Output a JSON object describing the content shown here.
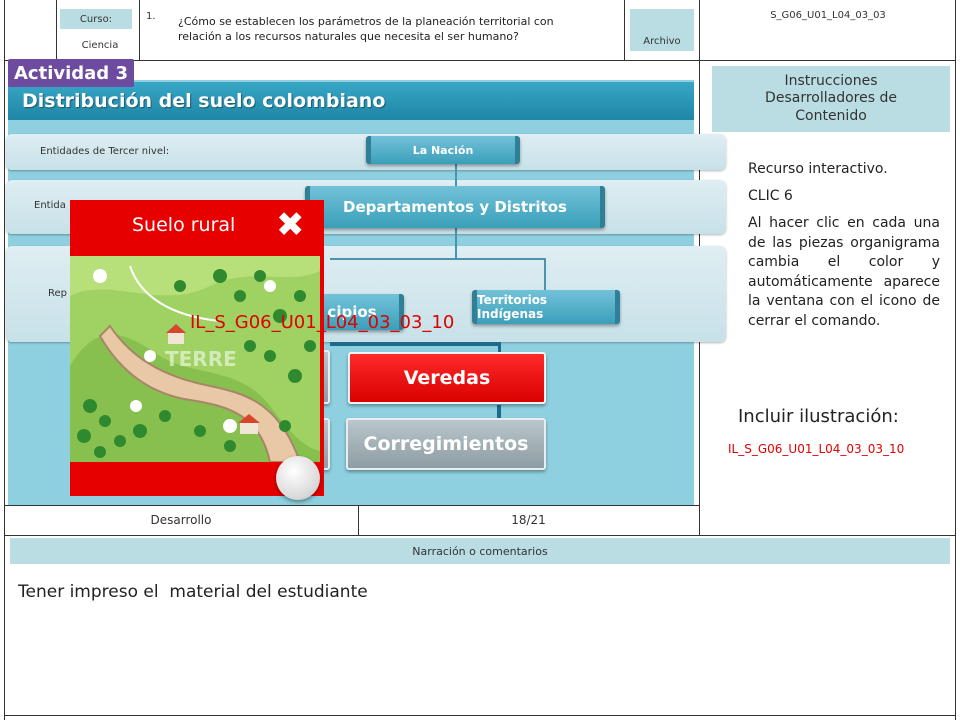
{
  "header": {
    "course_label": "Curso:",
    "subject": "Ciencia",
    "question_number": "1.",
    "question": "¿Cómo se establecen los parámetros de la planeación territorial con relación a los recursos naturales que necesita el ser humano?",
    "archive_label": "Archivo",
    "file_code": "S_G06_U01_L04_03_03"
  },
  "slide": {
    "activity_label": "Actividad 3",
    "title": "Distribución del suelo colombiano",
    "band1_label": "Entidades de Tercer nivel:",
    "band2_label": "Entida",
    "band3_label": "Rep",
    "node_nacion": "La Nación",
    "node_departamentos": "Departamentos y Distritos",
    "node_municipios": "cipios",
    "node_territorios": "Territorios Indígenas",
    "node_veredas": "Veredas",
    "node_corregimientos": "Corregimientos",
    "illustration_code": "IL_S_G06_U01_L04_03_03_10"
  },
  "popup": {
    "title": "Suelo rural",
    "watermark": "TERRE"
  },
  "footer_row": {
    "section": "Desarrollo",
    "page": "18/21"
  },
  "instructions": {
    "header": "Instrucciones Desarrolladores de Contenido",
    "resource": "Recurso interactivo.",
    "clic": "CLIC 6",
    "body": "Al hacer clic en cada una de las piezas organigrama cambia el color y automáticamente aparece la ventana con el icono de cerrar el comando.",
    "include_label": "Incluir ilustración:",
    "include_code": "IL_S_G06_U01_L04_03_03_10"
  },
  "narration": {
    "header": "Narración o comentarios",
    "text": "Tener impreso el  material del estudiante"
  },
  "colors": {
    "activity_purple": "#6d4b9e",
    "popup_red": "#e60000",
    "accent_teal": "#1f86a6",
    "light_teal": "#b9dde3"
  }
}
